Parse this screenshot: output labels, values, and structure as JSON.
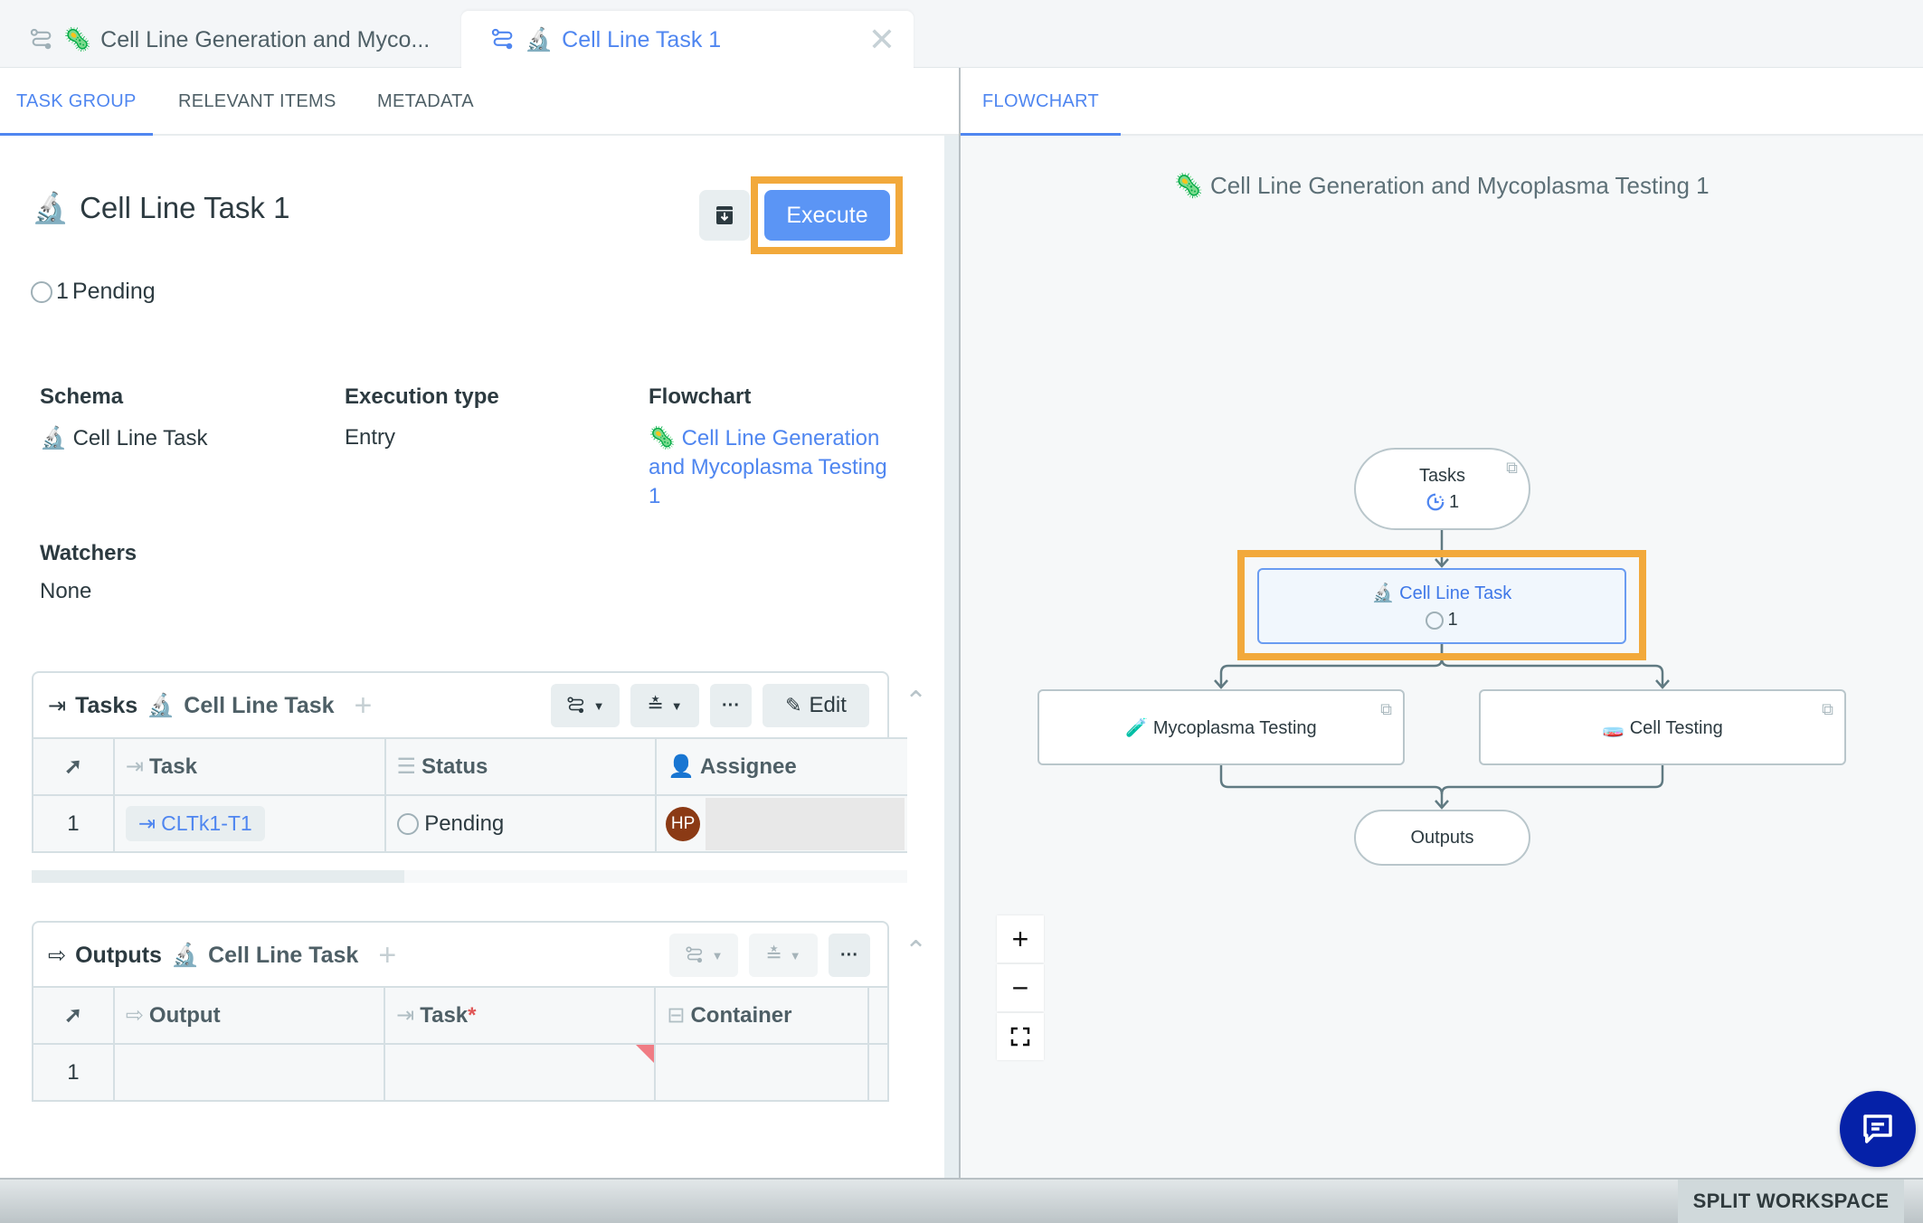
{
  "tabs": [
    {
      "label": "Cell Line Generation and Myco...",
      "emoji": "🦠",
      "active": false
    },
    {
      "label": "Cell Line Task 1",
      "emoji": "🔬",
      "active": true,
      "close": "✕"
    }
  ],
  "left_subtabs": [
    {
      "label": "TASK GROUP",
      "active": true
    },
    {
      "label": "RELEVANT ITEMS",
      "active": false
    },
    {
      "label": "METADATA",
      "active": false
    }
  ],
  "right_subtabs": [
    {
      "label": "FLOWCHART",
      "active": true
    }
  ],
  "header": {
    "emoji": "🔬",
    "title": "Cell Line Task 1",
    "status_count": "1",
    "status_label": "Pending",
    "execute_label": "Execute"
  },
  "fields": {
    "schema_label": "Schema",
    "schema_emoji": "🔬",
    "schema_value": "Cell Line Task",
    "execution_type_label": "Execution type",
    "execution_type_value": "Entry",
    "flowchart_label": "Flowchart",
    "flowchart_emoji": "🦠",
    "flowchart_value": "Cell Line Generation and Mycoplasma Testing 1",
    "watchers_label": "Watchers",
    "watchers_value": "None"
  },
  "tasks_card": {
    "title": "Tasks",
    "schema_emoji": "🔬",
    "schema": "Cell Line Task",
    "edit_label": "Edit",
    "columns": [
      "Task",
      "Status",
      "Assignee"
    ],
    "rows": [
      {
        "num": "1",
        "task": "CLTk1-T1",
        "status": "Pending",
        "assignee_initials": "HP"
      }
    ]
  },
  "outputs_card": {
    "title": "Outputs",
    "schema_emoji": "🔬",
    "schema": "Cell Line Task",
    "columns": [
      "Output",
      "Task",
      "Container"
    ],
    "required_marker": "*",
    "rows": [
      {
        "num": "1",
        "output": "",
        "task": "",
        "container": ""
      }
    ]
  },
  "flowchart": {
    "title_emoji": "🦠",
    "title": "Cell Line Generation and Mycoplasma Testing 1",
    "nodes": {
      "tasks": {
        "label": "Tasks",
        "count": "1"
      },
      "cell_line_task": {
        "emoji": "🔬",
        "label": "Cell Line Task",
        "count": "1"
      },
      "mycoplasma": {
        "emoji": "🧪",
        "label": "Mycoplasma Testing"
      },
      "cell_testing": {
        "emoji": "🧫",
        "label": "Cell Testing"
      },
      "outputs": {
        "label": "Outputs"
      }
    },
    "zoom_in": "+",
    "zoom_out": "−"
  },
  "footer": {
    "split_workspace": "SPLIT WORKSPACE"
  },
  "colors": {
    "accent": "#4f86f0",
    "execute": "#5b95f5",
    "highlight": "#f2a93b",
    "avatar": "#8b3a15",
    "chat": "#0521a8"
  }
}
